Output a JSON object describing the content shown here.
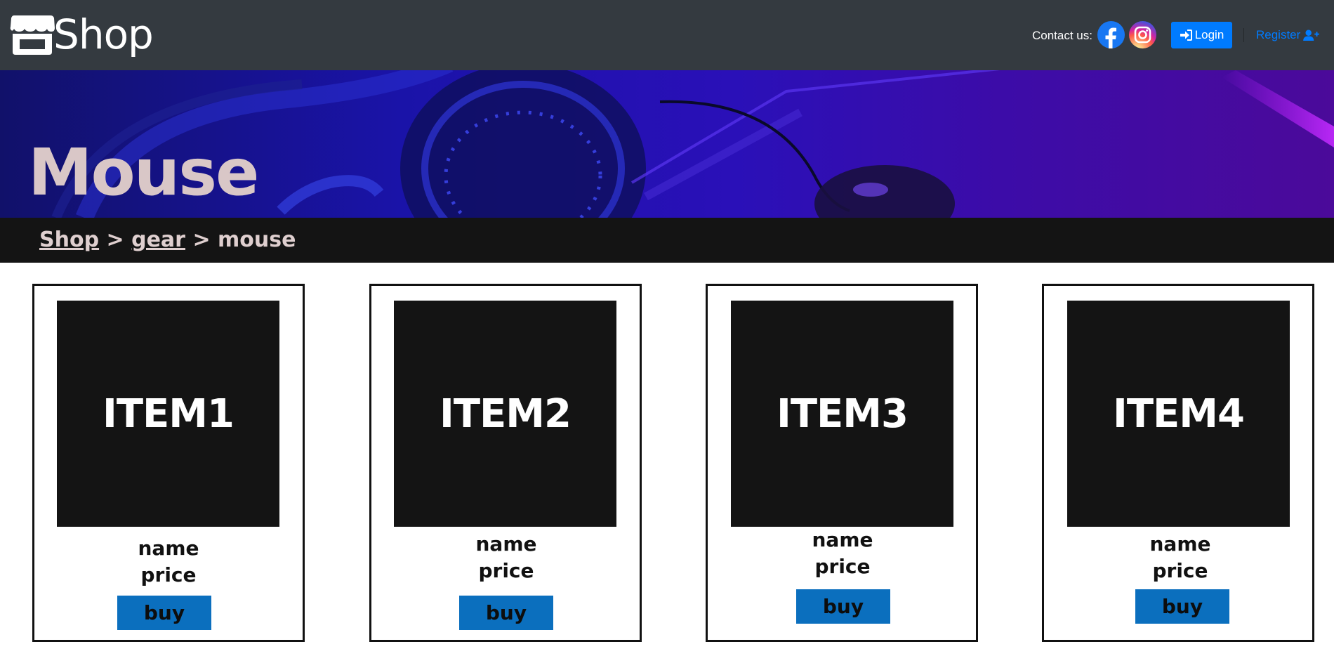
{
  "header": {
    "brand": "Shop",
    "contact_label": "Contact us:",
    "login_label": "Login",
    "register_label": "Register"
  },
  "hero": {
    "title": "Mouse"
  },
  "breadcrumb": {
    "items": [
      "Shop",
      "gear",
      "mouse"
    ],
    "separator": ">"
  },
  "products": [
    {
      "image_label": "ITEM1",
      "name": "name",
      "price": "price",
      "buy_label": "buy"
    },
    {
      "image_label": "ITEM2",
      "name": "name",
      "price": "price",
      "buy_label": "buy"
    },
    {
      "image_label": "ITEM3",
      "name": "name",
      "price": "price",
      "buy_label": "buy"
    },
    {
      "image_label": "ITEM4",
      "name": "name",
      "price": "price",
      "buy_label": "buy"
    }
  ],
  "colors": {
    "header_bg": "#343a40",
    "primary": "#007bff",
    "buy_button": "#0b6fbe",
    "breadcrumb_bg": "#141414",
    "hero_text": "#d9c7c7"
  },
  "icons": {
    "brand": "storefront-icon",
    "facebook": "facebook-icon",
    "instagram": "instagram-icon",
    "login": "sign-in-icon",
    "register": "user-plus-icon"
  }
}
